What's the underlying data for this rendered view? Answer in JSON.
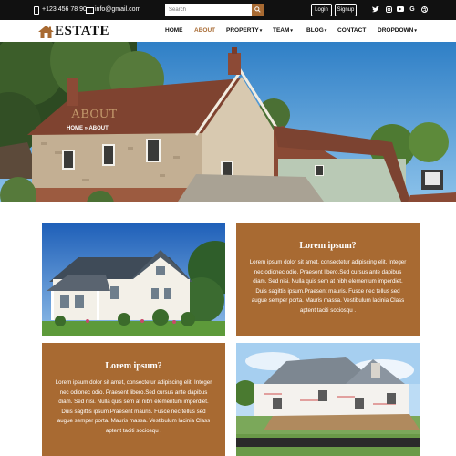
{
  "topbar": {
    "phone": "+123 456 78 90",
    "email": "info@gmail.com",
    "search_placeholder": "Search",
    "login_label": "Login",
    "signup_label": "Signup",
    "social_icons": [
      "twitter-icon",
      "instagram-icon",
      "youtube-icon",
      "google-icon",
      "dribbble-icon"
    ]
  },
  "brand": {
    "logo_text": "ESTATE",
    "accent": "#a86a32"
  },
  "nav": {
    "items": [
      {
        "label": "HOME",
        "dropdown": false
      },
      {
        "label": "ABOUT",
        "dropdown": false,
        "active": true
      },
      {
        "label": "PROPERTY",
        "dropdown": true
      },
      {
        "label": "TEAM",
        "dropdown": true
      },
      {
        "label": "BLOG",
        "dropdown": true
      },
      {
        "label": "CONTACT",
        "dropdown": false
      },
      {
        "label": "DROPDOWN",
        "dropdown": true
      }
    ],
    "caret": "▾"
  },
  "hero": {
    "title": "ABOUT",
    "breadcrumb_home": "HOME",
    "breadcrumb_sep": "»",
    "breadcrumb_current": "ABOUT"
  },
  "cards": [
    {
      "title": "Lorem ipsum?",
      "body": "Lorem ipsum dolor sit amet, consectetur adipiscing elit. Integer nec odionec odio. Praesent libero.Sed cursus ante dapibus diam. Sed nisi. Nulla quis sem at nibh elementum imperdiet. Duis sagittis ipsum.Praesent mauris. Fusce nec tellus sed augue semper porta. Mauris massa. Vestibulum lacinia Class aptent taciti sociosqu ."
    },
    {
      "title": "Lorem ipsum?",
      "body": "Lorem ipsum dolor sit amet, consectetur adipiscing elit. Integer nec odionec odio. Praesent libero.Sed cursus ante dapibus diam. Sed nisi. Nulla quis sem at nibh elementum imperdiet. Duis sagittis ipsum.Praesent mauris. Fusce nec tellus sed augue semper porta. Mauris massa. Vestibulum lacinia Class aptent taciti sociosqu ."
    }
  ]
}
